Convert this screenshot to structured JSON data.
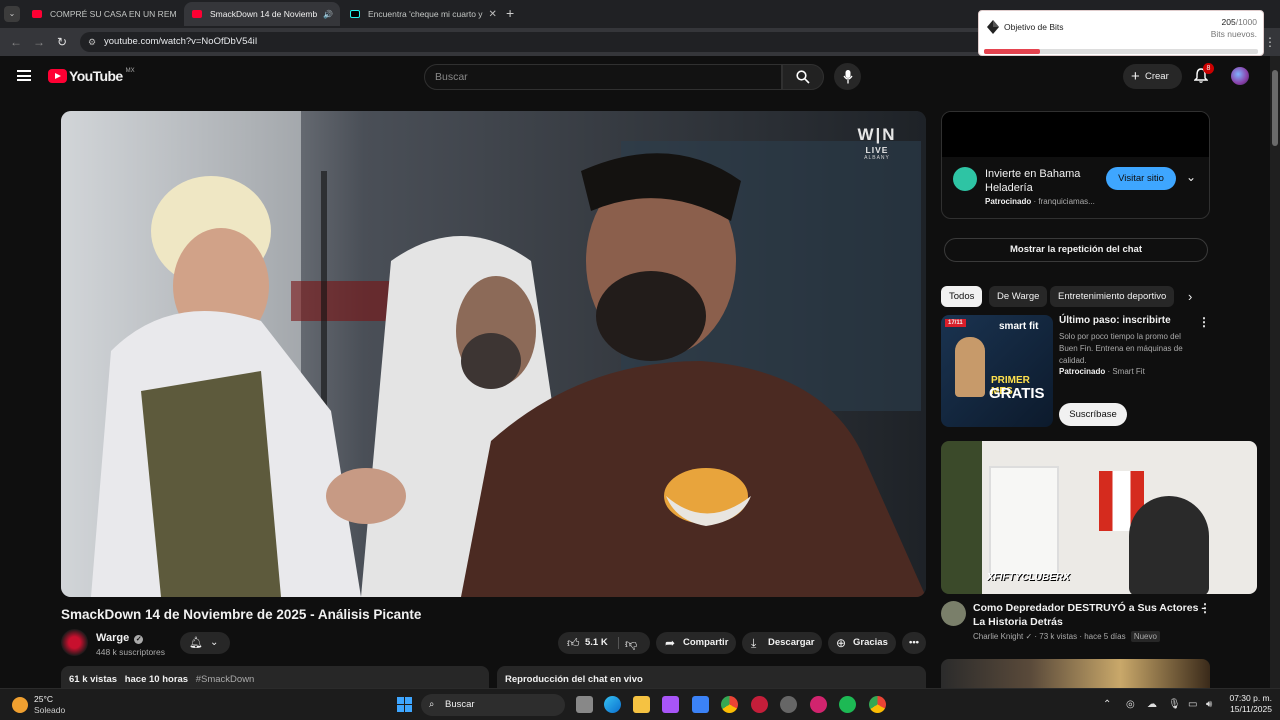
{
  "browser": {
    "tabs": [
      {
        "label": "COMPRÉ SU CASA EN UN REM",
        "active": false
      },
      {
        "label": "SmackDown 14 de Noviemb",
        "active": true
      },
      {
        "label": "Encuentra 'cheque mi cuarto y",
        "active": false
      }
    ],
    "new_tab": "+",
    "url": "youtube.com/watch?v=NoOfDbV54iI"
  },
  "bits_popup": {
    "title": "Objetivo de Bits",
    "current": "205",
    "total": "/1000",
    "subtitle": "Bits nuevos.",
    "progress_fraction": 0.205
  },
  "youtube": {
    "logo": "YouTube",
    "region": "MX",
    "search_placeholder": "Buscar",
    "create_label": "Crear",
    "notifications_count": "8"
  },
  "video": {
    "overlay_live": "LIVE",
    "overlay_city": "ALBANY",
    "title": "SmackDown 14 de Noviembre de 2025 - Análisis Picante",
    "channel": "Warge",
    "subscribers": "448 k suscriptores",
    "likes": "5.1 K",
    "share_label": "Compartir",
    "download_label": "Descargar",
    "thanks_label": "Gracias",
    "views": "61 k vistas",
    "time_ago": "hace 10 horas",
    "hashtag": "#SmackDown",
    "chat_replay_label": "Reproducción del chat en vivo"
  },
  "sidebar": {
    "ad": {
      "title_line1": "Invierte en Bahama",
      "title_line2": "Heladería",
      "sponsored": "Patrocinado",
      "advertiser": "franquiciamas...",
      "cta": "Visitar sitio"
    },
    "show_chat_replay": "Mostrar la repetición del chat",
    "chips": [
      "Todos",
      "De Warge",
      "Entretenimiento deportivo"
    ],
    "promo": {
      "title": "Último paso: inscribirte",
      "description": "Solo por poco tiempo la promo del Buen Fin. Entrena en máquinas de calidad.",
      "sponsored": "Patrocinado",
      "advertiser": "Smart Fit",
      "cta": "Suscríbase",
      "thumb_brand": "smart fit",
      "thumb_line1": "PRIMER MES",
      "thumb_line2": "GRATIS",
      "thumb_date": "17/11"
    },
    "rec_video": {
      "title_line1": "Como Depredador DESTRUYÓ a Sus Actores -",
      "title_line2": "La Historia Detrás",
      "channel": "Charlie Knight",
      "views": "73 k vistas",
      "age": "hace 5 días",
      "badge": "Nuevo",
      "thumb_text": "XFIFTYCLUBERX"
    }
  },
  "taskbar": {
    "weather_temp": "25°C",
    "weather_desc": "Soleado",
    "search_label": "Buscar",
    "time": "07:30 p. m.",
    "date": "15/11/2025"
  }
}
